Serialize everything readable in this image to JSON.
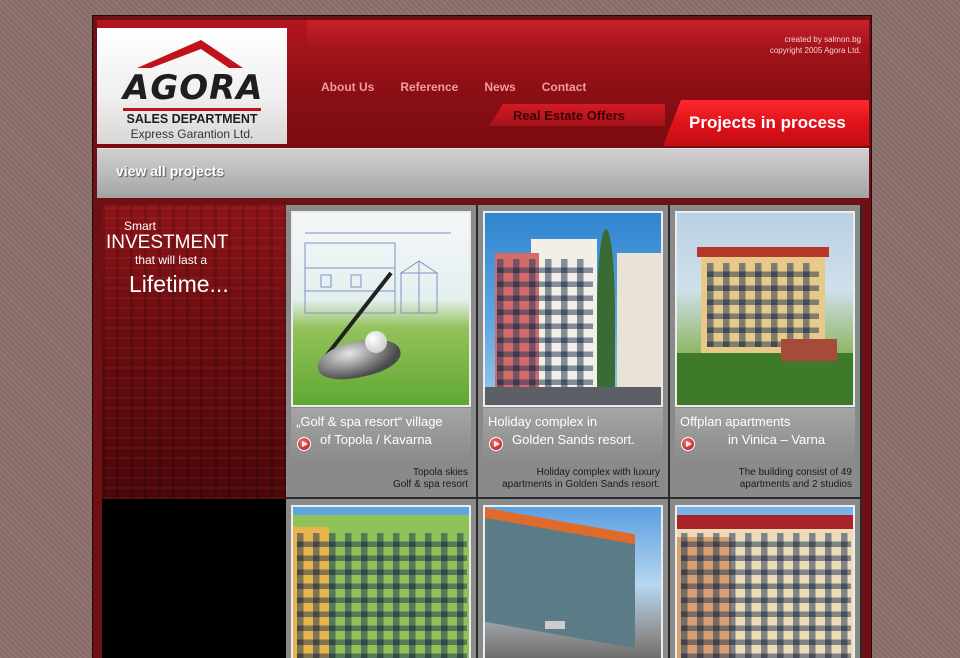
{
  "header": {
    "logo": {
      "word": "AGORA",
      "sales_department": "SALES DEPARTMENT",
      "company": "Express Garantion Ltd."
    },
    "credit": {
      "line1": "created by salmon.bg",
      "line2": "copyright 2005 Agora Ltd."
    },
    "nav": [
      {
        "label": "About Us"
      },
      {
        "label": "Reference"
      },
      {
        "label": "News"
      },
      {
        "label": "Contact"
      }
    ],
    "tabs": {
      "real_estate_offers": "Real Estate Offers",
      "projects_in_process": "Projects in process"
    }
  },
  "subbar": {
    "view_all": "view all projects"
  },
  "promo": {
    "line1": "Smart",
    "line2": "INVESTMENT",
    "line3": "that will last a",
    "line4": "Lifetime..."
  },
  "projects": [
    {
      "title_line1": "„Golf & spa resort“ village",
      "title_line2": "of Topola / Kavarna",
      "desc_line1": "Topola skies",
      "desc_line2": "Golf & spa resort"
    },
    {
      "title_line1": "Holiday complex in",
      "title_line2": "Golden Sands resort.",
      "desc_line1": "Holiday complex with luxury",
      "desc_line2": "apartments in Golden Sands resort."
    },
    {
      "title_line1": "Offplan apartments",
      "title_line2": "in Vinica – Varna",
      "desc_line1": "The building consist of 49",
      "desc_line2": "apartments and 2 studios"
    }
  ],
  "colors": {
    "brand_red": "#c0121b",
    "nav_pink": "#f39ba0",
    "active_tab_red": "#e0121a"
  }
}
